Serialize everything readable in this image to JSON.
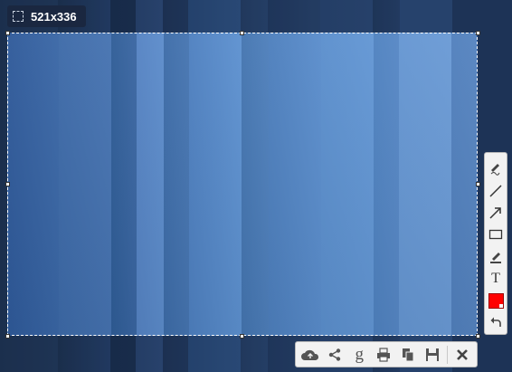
{
  "selection": {
    "size_label": "521x336",
    "size_icon": "selection-icon"
  },
  "side_toolbar": {
    "tools": [
      {
        "name": "pen-icon"
      },
      {
        "name": "line-icon"
      },
      {
        "name": "arrow-icon"
      },
      {
        "name": "rectangle-icon"
      },
      {
        "name": "marker-icon"
      },
      {
        "name": "text-icon",
        "label": "T"
      },
      {
        "name": "color-picker",
        "color": "#ff0000"
      },
      {
        "name": "undo-icon"
      }
    ]
  },
  "bottom_toolbar": {
    "tools": [
      {
        "name": "upload-cloud-icon"
      },
      {
        "name": "share-icon"
      },
      {
        "name": "google-search-icon",
        "label": "g"
      },
      {
        "name": "print-icon"
      },
      {
        "name": "copy-icon"
      },
      {
        "name": "save-icon"
      },
      {
        "name": "close-icon"
      }
    ]
  }
}
